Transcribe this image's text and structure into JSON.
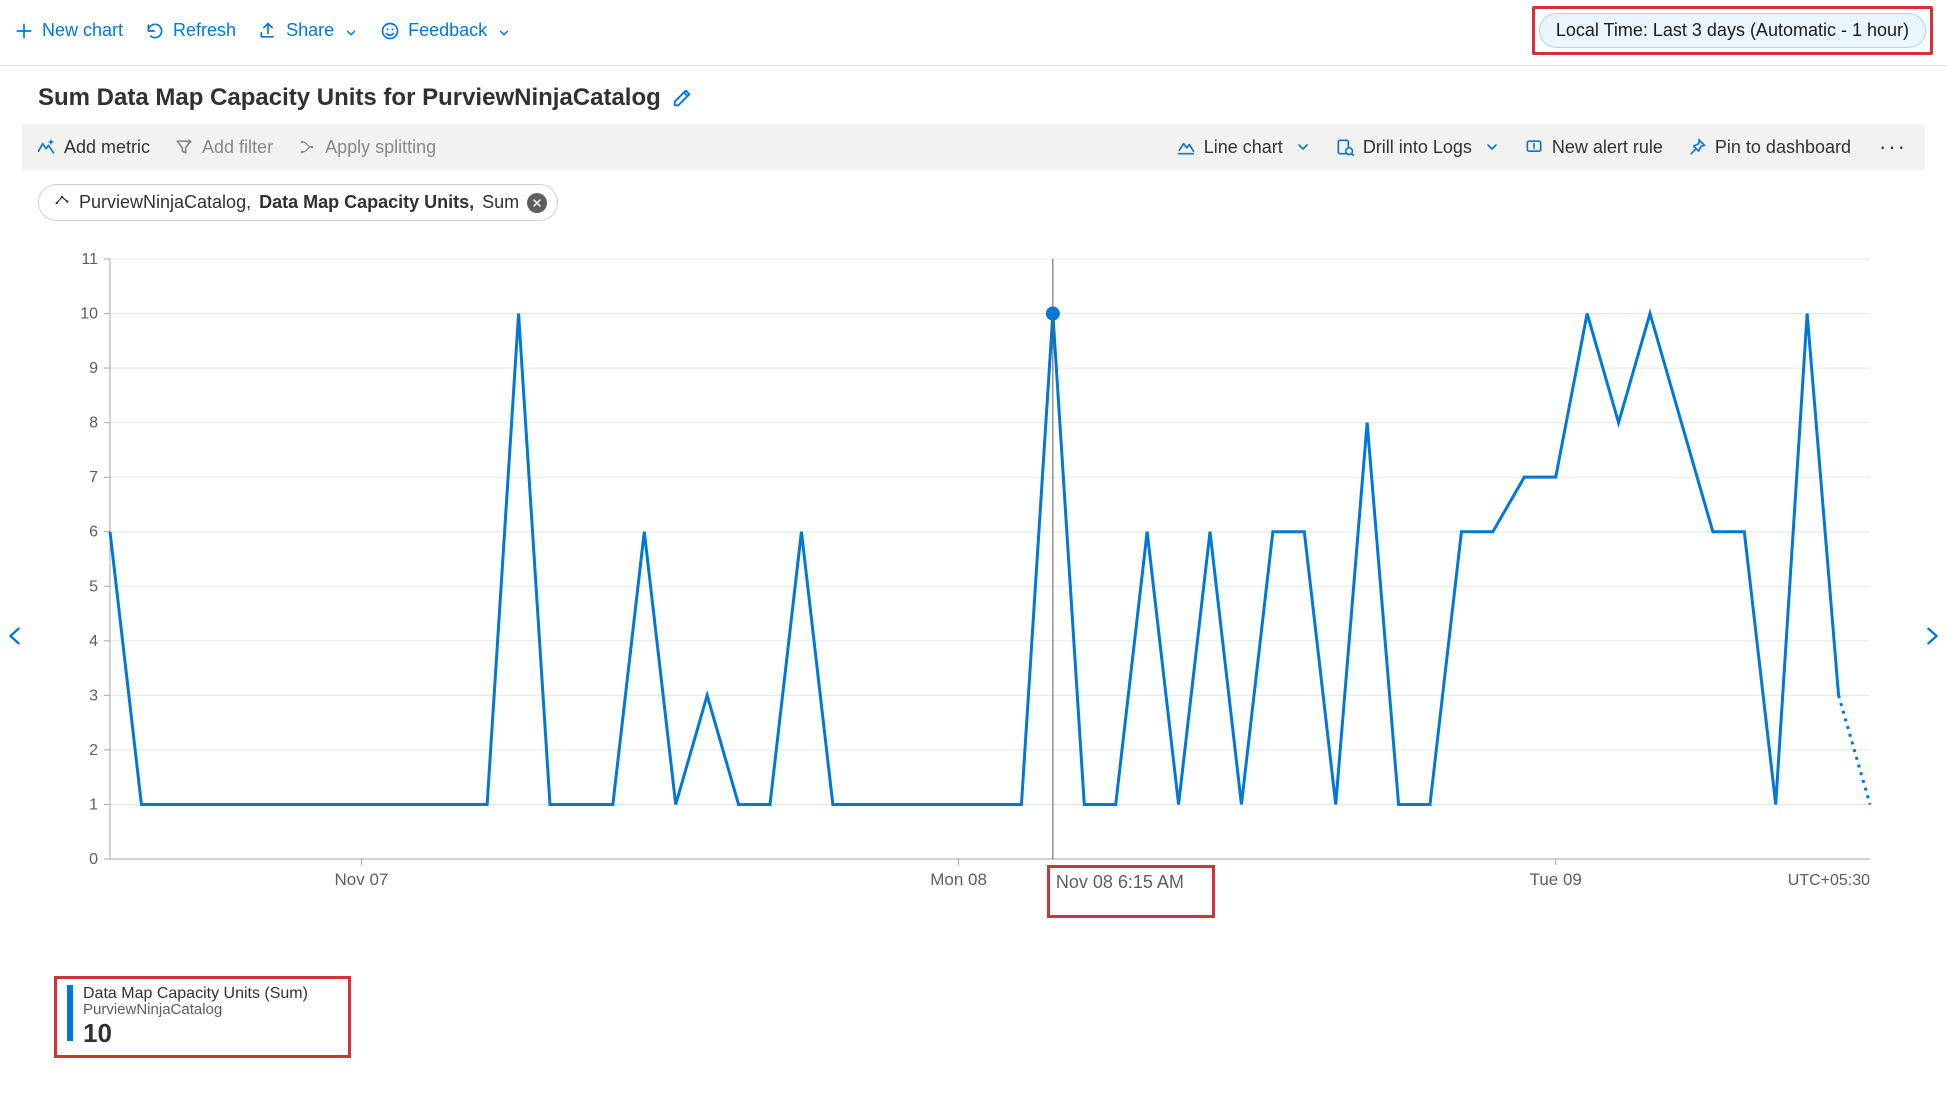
{
  "toolbar": {
    "new_chart": "New chart",
    "refresh": "Refresh",
    "share": "Share",
    "feedback": "Feedback",
    "time_range": "Local Time: Last 3 days (Automatic - 1 hour)"
  },
  "title": "Sum Data Map Capacity Units for PurviewNinjaCatalog",
  "metric_bar": {
    "add_metric": "Add metric",
    "add_filter": "Add filter",
    "apply_splitting": "Apply splitting",
    "line_chart": "Line chart",
    "drill_logs": "Drill into Logs",
    "new_alert": "New alert rule",
    "pin_dashboard": "Pin to dashboard"
  },
  "metric_chip": {
    "resource": "PurviewNinjaCatalog,",
    "metric": "Data Map Capacity Units,",
    "aggregation": "Sum"
  },
  "hover": {
    "label": "Nov 08 6:15 AM",
    "index": 30
  },
  "legend": {
    "title": "Data Map Capacity Units (Sum)",
    "subtitle": "PurviewNinjaCatalog",
    "value": "10"
  },
  "timezone": "UTC+05:30",
  "chart_data": {
    "type": "line",
    "title": "Sum Data Map Capacity Units for PurviewNinjaCatalog",
    "xlabel": "",
    "ylabel": "",
    "ylim": [
      0,
      11
    ],
    "y_ticks": [
      0,
      1,
      2,
      3,
      4,
      5,
      6,
      7,
      8,
      9,
      10,
      11
    ],
    "x_tick_labels": [
      "Nov 07",
      "Mon 08",
      "Tue 09"
    ],
    "x_tick_indices": [
      8,
      27,
      46
    ],
    "series": [
      {
        "name": "Data Map Capacity Units (Sum) – PurviewNinjaCatalog",
        "color": "#0078d4",
        "values": [
          6,
          1,
          1,
          1,
          1,
          1,
          1,
          1,
          1,
          1,
          1,
          1,
          1,
          10,
          1,
          1,
          1,
          6,
          1,
          3,
          1,
          1,
          6,
          1,
          1,
          1,
          1,
          1,
          1,
          1,
          10,
          1,
          1,
          6,
          1,
          6,
          1,
          6,
          6,
          1,
          8,
          1,
          1,
          6,
          6,
          7,
          7,
          10,
          8,
          10,
          8,
          6,
          6,
          1,
          10,
          3,
          1
        ],
        "dotted_tail_from_index": 55
      }
    ]
  }
}
